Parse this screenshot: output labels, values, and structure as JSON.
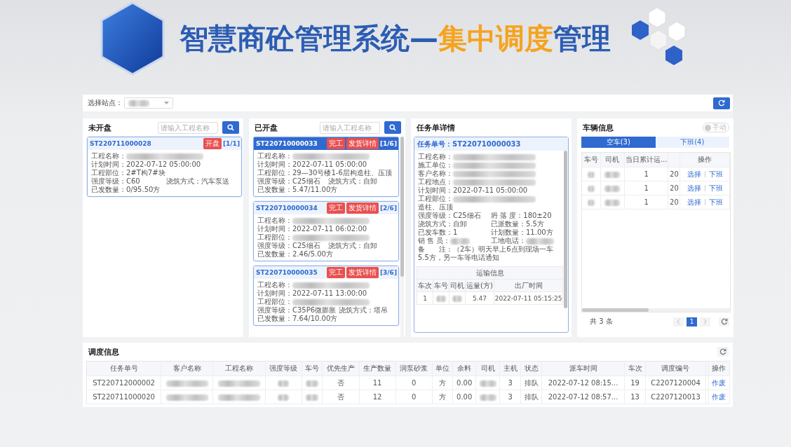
{
  "title": {
    "parts": [
      {
        "text": "智慧商砼管理系统—",
        "highlight": false
      },
      {
        "text": "集中调度",
        "highlight": true
      },
      {
        "text": "管理",
        "highlight": false
      }
    ]
  },
  "station": {
    "label": "选择站点："
  },
  "panels": [
    {
      "title": "未开盘",
      "search_placeholder": "请输入工程名称",
      "cards": [
        {
          "code": "ST220711000028",
          "selected": false,
          "buttons": [
            "开盘"
          ],
          "position": "[1/1]",
          "rows": [
            [
              {
                "label": "工程名称："
              }
            ],
            [
              {
                "label": "计划时间：",
                "value": "2022-07-12 05:00:00"
              }
            ],
            [
              {
                "label": "工程部位：",
                "value": "2#T构7#块"
              }
            ],
            [
              {
                "label": "强度等级：",
                "value": "C60"
              },
              {
                "label": "浇筑方式：",
                "value": "汽车泵送"
              }
            ],
            [
              {
                "label": "已发数量：",
                "value": "0/95.50方"
              }
            ]
          ]
        }
      ]
    },
    {
      "title": "已开盘",
      "search_placeholder": "请输入工程名称",
      "cards": [
        {
          "code": "ST220710000033",
          "selected": true,
          "buttons": [
            "完工",
            "发货详情"
          ],
          "position": "[1/6]",
          "rows": [
            [
              {
                "label": "工程名称："
              }
            ],
            [
              {
                "label": "计划时间：",
                "value": "2022-07-11 05:00:00"
              }
            ],
            [
              {
                "label": "工程部位：",
                "value": "29—30号楼1-6层构造柱、压顶"
              }
            ],
            [
              {
                "label": "强度等级：",
                "value": "C25细石"
              },
              {
                "label": "浇筑方式：",
                "value": "自卸"
              }
            ],
            [
              {
                "label": "已发数量：",
                "value": "5.47/11.00方"
              }
            ]
          ]
        },
        {
          "code": "ST220710000034",
          "selected": false,
          "buttons": [
            "完工",
            "发货详情"
          ],
          "position": "[2/6]",
          "rows": [
            [
              {
                "label": "工程名称："
              }
            ],
            [
              {
                "label": "计划时间：",
                "value": "2022-07-11 06:02:00"
              }
            ],
            [
              {
                "label": "工程部位："
              }
            ],
            [
              {
                "label": "强度等级：",
                "value": "C25细石"
              },
              {
                "label": "浇筑方式：",
                "value": "自卸"
              }
            ],
            [
              {
                "label": "已发数量：",
                "value": "2.46/5.00方"
              }
            ]
          ]
        },
        {
          "code": "ST220710000035",
          "selected": false,
          "buttons": [
            "完工",
            "发货详情"
          ],
          "position": "[3/6]",
          "rows": [
            [
              {
                "label": "工程名称："
              }
            ],
            [
              {
                "label": "计划时间：",
                "value": "2022-07-11 13:00:00"
              }
            ],
            [
              {
                "label": "工程部位："
              }
            ],
            [
              {
                "label": "强度等级：",
                "value": "C35P6微膨胀"
              },
              {
                "label": "浇筑方式：",
                "value": "塔吊"
              }
            ],
            [
              {
                "label": "已发数量：",
                "value": "7.64/10.00方"
              }
            ]
          ]
        }
      ]
    }
  ],
  "detail": {
    "title": "任务单详情",
    "header": "任务单号：ST220710000033",
    "rows": [
      [
        {
          "label": "工程名称："
        }
      ],
      [
        {
          "label": "施工单位："
        }
      ],
      [
        {
          "label": "客户名称："
        }
      ],
      [
        {
          "label": "工程地点："
        }
      ],
      [
        {
          "label": "计划时间：",
          "value": "2022-07-11 05:00:00"
        }
      ],
      [
        {
          "label": "工程部位：",
          "value": "造柱、压顶",
          "redacted_prefix": true
        }
      ],
      [
        {
          "label": "强度等级：",
          "value": "C25细石"
        },
        {
          "label": "坍 落 度：",
          "value": "180±20"
        }
      ],
      [
        {
          "label": "浇筑方式：",
          "value": "自卸"
        },
        {
          "label": "已派数量：",
          "value": "5.5方"
        }
      ],
      [
        {
          "label": "已发车数：",
          "value": "1"
        },
        {
          "label": "计划数量：",
          "value": "11.00方"
        }
      ],
      [
        {
          "label": "销 售 员："
        },
        {
          "label": "工地电话："
        }
      ],
      [
        {
          "label": "备　　注：",
          "value": "（2车）明天早上6点到现场一车5.5方，另一车等电话通知"
        }
      ]
    ],
    "transport": {
      "title": "运输信息",
      "columns": [
        "车次",
        "车号",
        "司机",
        "运量(方)",
        "出厂时间"
      ],
      "rows": [
        [
          "1",
          null,
          null,
          "5.47",
          "2022-07-11 05:15:25"
        ]
      ]
    }
  },
  "vehicles": {
    "title": "车辆信息",
    "toggle": {
      "label": "手动",
      "on": false
    },
    "tabs": [
      {
        "label": "空车(3)",
        "selected": true
      },
      {
        "label": "下班(4)",
        "selected": false
      }
    ],
    "columns": [
      "车号",
      "司机",
      "当日累计运..."
    ],
    "action_column": "操作",
    "rows": [
      {
        "cells": [
          null,
          null,
          "1",
          "20"
        ],
        "actions": [
          "选择",
          "下班"
        ]
      },
      {
        "cells": [
          null,
          null,
          "1",
          "20"
        ],
        "actions": [
          "选择",
          "下班"
        ]
      },
      {
        "cells": [
          null,
          null,
          "1",
          "20"
        ],
        "actions": [
          "选择",
          "下班"
        ]
      }
    ],
    "total": "共 3 条",
    "page": "1"
  },
  "dispatch": {
    "title": "调度信息",
    "columns": [
      "任务单号",
      "客户名称",
      "工程名称",
      "强度等级",
      "车号",
      "优先生产",
      "生产数量",
      "润泵砂浆",
      "单位",
      "余料",
      "司机",
      "主机",
      "状态",
      "派车时间",
      "车次",
      "调度编号"
    ],
    "action_column": "操作",
    "rows": [
      {
        "cells": [
          "ST220712000002",
          null,
          null,
          null,
          null,
          "否",
          "11",
          "0",
          "方",
          "0.00",
          null,
          "3",
          "排队",
          "2022-07-12 08:15...",
          "19",
          "C2207120004"
        ],
        "action": "作废"
      },
      {
        "cells": [
          "ST220711000020",
          null,
          null,
          null,
          null,
          "否",
          "12",
          "0",
          "方",
          "0.00",
          null,
          "3",
          "排队",
          "2022-07-12 08:57...",
          "13",
          "C2207120013"
        ],
        "action": "作废"
      }
    ]
  }
}
